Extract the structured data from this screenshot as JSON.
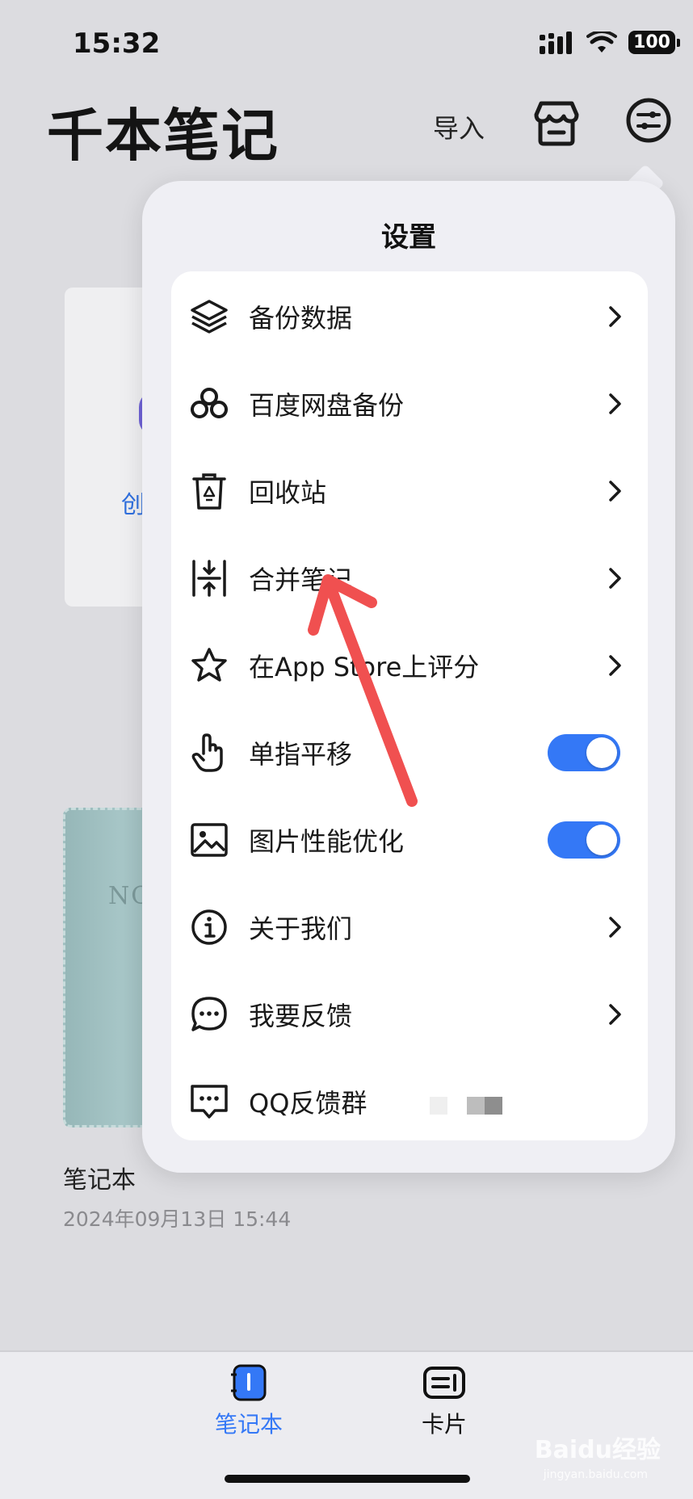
{
  "status_bar": {
    "time": "15:32",
    "battery": "100"
  },
  "header": {
    "title": "千本笔记",
    "import_label": "导入"
  },
  "background": {
    "create_label": "创",
    "cover_text": "NO",
    "notebook_name": "笔记本",
    "notebook_date": "2024年09月13日 15:44"
  },
  "settings": {
    "title": "设置",
    "items": [
      {
        "label": "备份数据",
        "icon": "layers-icon",
        "control": "chevron"
      },
      {
        "label": "百度网盘备份",
        "icon": "cloud-icon",
        "control": "chevron"
      },
      {
        "label": "回收站",
        "icon": "recycle-bin-icon",
        "control": "chevron"
      },
      {
        "label": "合并笔记",
        "icon": "merge-icon",
        "control": "chevron"
      },
      {
        "label": "在App Store上评分",
        "icon": "star-icon",
        "control": "chevron"
      },
      {
        "label": "单指平移",
        "icon": "hand-pointer-icon",
        "control": "toggle",
        "on": true
      },
      {
        "label": "图片性能优化",
        "icon": "image-icon",
        "control": "toggle",
        "on": true
      },
      {
        "label": "关于我们",
        "icon": "info-icon",
        "control": "chevron"
      },
      {
        "label": "我要反馈",
        "icon": "chat-bubble-icon",
        "control": "chevron"
      },
      {
        "label": "QQ反馈群",
        "icon": "message-icon",
        "control": "none"
      }
    ]
  },
  "tabbar": {
    "tabs": [
      {
        "label": "笔记本",
        "active": true
      },
      {
        "label": "卡片",
        "active": false
      }
    ]
  },
  "colors": {
    "accent": "#3478f6",
    "annotation_arrow": "#f05050"
  },
  "watermark": {
    "text": "Baidu经验",
    "sub": "jingyan.baidu.com"
  }
}
